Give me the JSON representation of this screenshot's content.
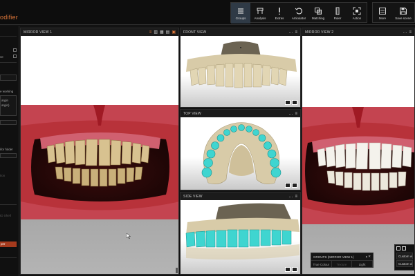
{
  "app": {
    "title": "odifier"
  },
  "toolbar": {
    "groups": [
      {
        "label": "Groups",
        "icon": "hamburger-icon"
      },
      {
        "label": "Analysis",
        "icon": "analysis-icon"
      },
      {
        "label": "Extras",
        "icon": "exclamation-icon"
      },
      {
        "label": "Articulator",
        "icon": "undo-icon"
      },
      {
        "label": "Matching",
        "icon": "matching-icon"
      },
      {
        "label": "Ruler",
        "icon": "ruler-icon"
      },
      {
        "label": "Action",
        "icon": "action-icon"
      }
    ],
    "right": [
      {
        "label": "More",
        "icon": "more-icon"
      },
      {
        "label": "Save scene",
        "icon": "save-icon"
      }
    ]
  },
  "sidebar": {
    "texts": [
      "ve",
      "e working",
      "argin",
      "argin)",
      "ifor folder",
      "tion",
      "ID Shell",
      "per"
    ]
  },
  "panels": {
    "mirror1": {
      "title": "MIRROR VIEW 1"
    },
    "front": {
      "title": "FRONT VIEW"
    },
    "top": {
      "title": "TOP VIEW"
    },
    "side": {
      "title": "SIDE VIEW"
    },
    "mirror2": {
      "title": "MIRROR VIEW 2"
    }
  },
  "groups_popup": {
    "title": "GROUPS (MIRROR VIEW 1)",
    "buttons": [
      "True Colour",
      "Texture",
      "Light"
    ]
  },
  "custom_views": {
    "items": [
      "Custom view",
      "Custom view"
    ]
  },
  "colors": {
    "accent": "#e0783a",
    "active_tool": "#2f3a46",
    "tooth_scan": "#d8cba8",
    "prep_teal": "#3fd5d0"
  }
}
